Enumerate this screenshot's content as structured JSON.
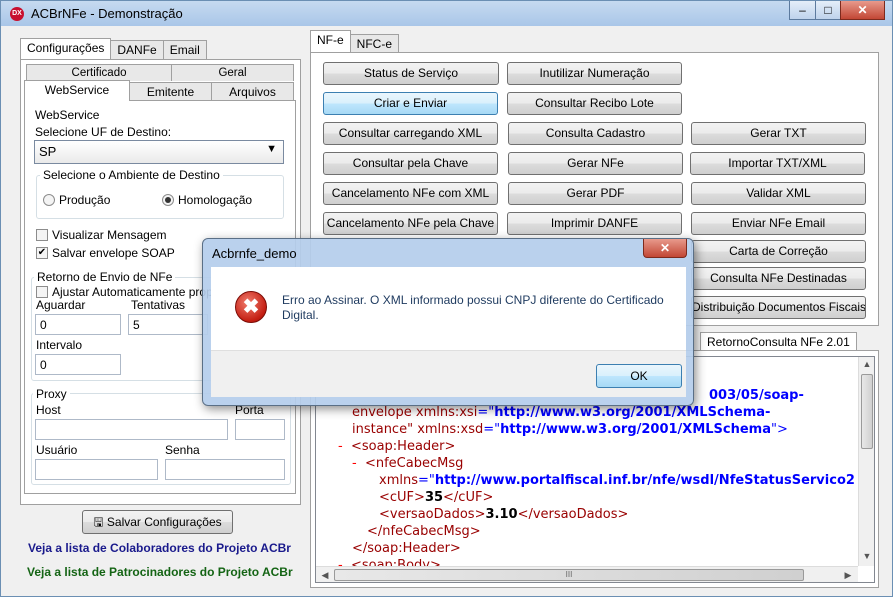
{
  "window": {
    "title": "ACBrNFe - Demonstração",
    "icon_text": "DX",
    "min": "–",
    "max": "□",
    "close": "✕"
  },
  "left_tabs": [
    "Configurações",
    "DANFe",
    "Email"
  ],
  "config_tabs_row1": [
    "Certificado",
    "Geral"
  ],
  "config_tabs_row2": [
    "WebService",
    "Emitente",
    "Arquivos"
  ],
  "webservice": {
    "group_title": "WebService",
    "uf_label": "Selecione UF de Destino:",
    "uf_value": "SP",
    "ambiente_title": "Selecione o Ambiente de Destino",
    "producao": "Produção",
    "homologacao": "Homologação",
    "visualizar": "Visualizar Mensagem",
    "salvar_envelope": "Salvar envelope SOAP",
    "retorno_title": "Retorno de Envio de NFe",
    "ajustar": "Ajustar Automaticamente prop. \"",
    "aguardar_label": "Aguardar",
    "aguardar_value": "0",
    "tentativas_label": "Tentativas",
    "tentativas_value": "5",
    "intervalo_label": "Intervalo",
    "intervalo_value": "0",
    "proxy_title": "Proxy",
    "host_label": "Host",
    "porta_label": "Porta",
    "usuario_label": "Usuário",
    "senha_label": "Senha"
  },
  "salvar_config": "Salvar Configurações",
  "links": {
    "colaboradores": "Veja a lista de Colaboradores do Projeto ACBr",
    "patrocinadores": "Veja a lista de Patrocinadores do Projeto ACBr"
  },
  "right_tabs": [
    "NF-e",
    "NFC-e"
  ],
  "buttons": {
    "status": "Status de Serviço",
    "inutilizar": "Inutilizar Numeração",
    "criar_enviar": "Criar e Enviar",
    "consultar_recibo": "Consultar Recibo Lote",
    "consultar_xml": "Consultar carregando XML",
    "consulta_cadastro": "Consulta Cadastro",
    "gerar_txt": "Gerar TXT",
    "consultar_chave": "Consultar pela Chave",
    "gerar_nfe": "Gerar NFe",
    "importar_txt": "Importar TXT/XML",
    "cancel_xml": "Cancelamento NFe com XML",
    "gerar_pdf": "Gerar PDF",
    "validar_xml": "Validar XML",
    "cancel_chave": "Cancelamento NFe pela Chave",
    "imprimir_danfe": "Imprimir DANFE",
    "enviar_email": "Enviar NFe Email",
    "carta_correcao": "Carta de Correção",
    "consulta_destinadas": "Consulta NFe Destinadas",
    "distribuicao": "Distribuição Documentos Fiscais"
  },
  "result_tab": "RetornoConsulta NFe 2.01",
  "xml": {
    "l1": "003/05/soap-",
    "l2a": "envelope",
    "l2b": " xmlns:xsi",
    "l2c": "=\"",
    "l2d": "http://www.w3.org/2001/XMLSchema-",
    "l3a": "instance",
    "l3b": "\" xmlns:xsd",
    "l3c": "=\"",
    "l3d": "http://www.w3.org/2001/XMLSchema",
    "l3e": "\">",
    "l4": "<soap:Header>",
    "l5": "<nfeCabecMsg",
    "l6a": "xmlns",
    "l6b": "=\"",
    "l6c": "http://www.portalfiscal.inf.br/nfe/wsdl/NfeStatusServico2",
    "l7a": "<cUF>",
    "l7b": "35",
    "l7c": "</cUF>",
    "l8a": "<versaoDados>",
    "l8b": "3.10",
    "l8c": "</versaoDados>",
    "l9": "</nfeCabecMsg>",
    "l10": "</soap:Header>",
    "l11": "<soap:Body>",
    "dash": "-"
  },
  "dialog": {
    "title": "Acbrnfe_demo",
    "message": "Erro ao Assinar. O XML informado possui CNPJ diferente do Certificado Digital.",
    "ok": "OK",
    "close": "✕",
    "icon": "✖"
  },
  "scroll": {
    "up": "▲",
    "down": "▼",
    "left": "◀",
    "right": "▶",
    "grip": "III"
  }
}
